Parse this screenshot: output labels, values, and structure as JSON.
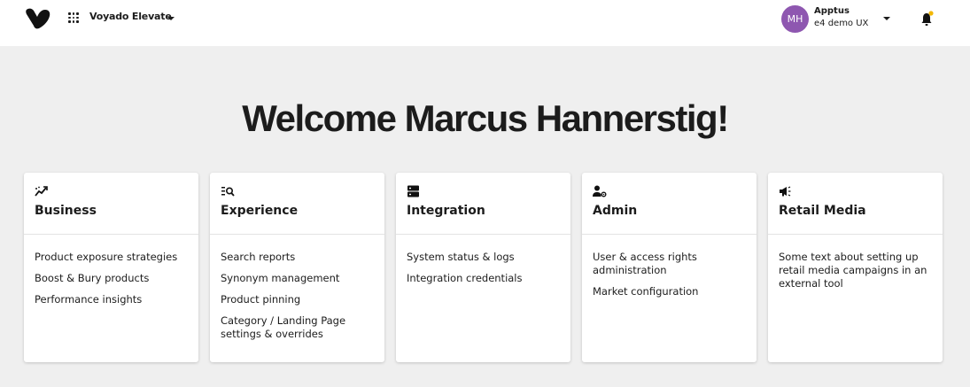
{
  "header": {
    "app_name": "Voyado Elevate",
    "account_initials": "MH",
    "account_name": "Apptus",
    "account_org": "e4 demo UX",
    "avatar_color": "#8e57b0",
    "notification_dot_color": "#f2b705"
  },
  "main": {
    "welcome": "Welcome Marcus Hannerstig!"
  },
  "cards": [
    {
      "icon": "trending-up-icon",
      "title": "Business",
      "links": [
        "Product exposure strategies",
        "Boost & Bury products",
        "Performance insights"
      ]
    },
    {
      "icon": "search-list-icon",
      "title": "Experience",
      "links": [
        "Search reports",
        "Synonym management",
        "Product pinning",
        "Category / Landing Page settings & overrides"
      ]
    },
    {
      "icon": "server-icon",
      "title": "Integration",
      "links": [
        "System status & logs",
        "Integration credentials"
      ]
    },
    {
      "icon": "user-settings-icon",
      "title": "Admin",
      "links": [
        "User & access rights administration",
        "Market configuration"
      ]
    },
    {
      "icon": "megaphone-icon",
      "title": "Retail Media",
      "text": "Some text about setting up retail media campaigns in an external tool"
    }
  ]
}
